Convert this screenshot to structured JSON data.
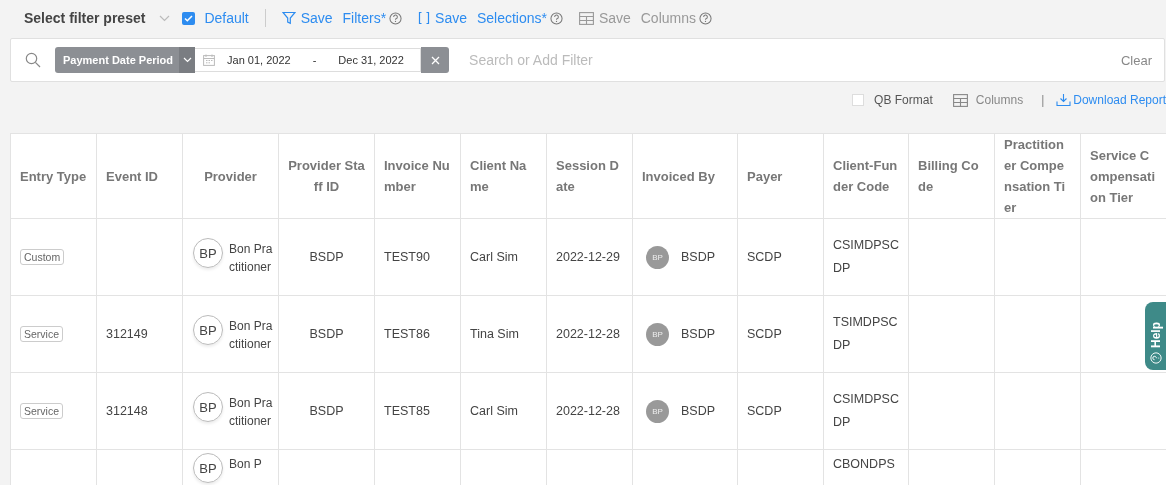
{
  "preset_bar": {
    "label": "Select filter preset",
    "default": {
      "label": "Default",
      "checked": true
    },
    "actions": [
      {
        "label": "Save Filters*",
        "disabled": false
      },
      {
        "label": "Save Selections*",
        "disabled": false
      },
      {
        "label": "Save Columns",
        "disabled": true
      }
    ]
  },
  "filter_bar": {
    "chip": "Payment Date Period",
    "date_from": "Jan 01, 2022",
    "date_separator": "-",
    "date_to": "Dec 31, 2022",
    "placeholder": "Search or Add Filter",
    "clear": "Clear"
  },
  "options": {
    "qb_format": {
      "label": "QB Format",
      "checked": false
    },
    "columns": "Columns",
    "separator": "|",
    "download": "Download Report"
  },
  "table": {
    "columns": [
      {
        "label": "Entry Type"
      },
      {
        "label": "Event ID"
      },
      {
        "label": "Provider"
      },
      {
        "label": "Provider Staff ID"
      },
      {
        "label": "Invoice Number"
      },
      {
        "label": "Client Name"
      },
      {
        "label": "Session Date"
      },
      {
        "label": "Invoiced By"
      },
      {
        "label": "Payer"
      },
      {
        "label": "Client-Funder Code"
      },
      {
        "label": "Billing Code"
      },
      {
        "label": "Practitioner Compensation Tier"
      },
      {
        "label": "Service Compensation Tier"
      }
    ],
    "rows": [
      {
        "entry_type": "Custom",
        "provider": {
          "initials": "BP",
          "name": "Bon Practitioner"
        },
        "staff_id": "BSDP",
        "invoice": "TEST90",
        "client": "Carl Sim",
        "session_date": "2022-12-29",
        "invoiced_by": {
          "initials": "BP",
          "name": "BSDP"
        },
        "payer": "SCDP",
        "funder_code": "CSIMDPSCDP"
      },
      {
        "entry_type": "Service",
        "event_id": "312149",
        "provider": {
          "initials": "BP",
          "name": "Bon Practitioner"
        },
        "staff_id": "BSDP",
        "invoice": "TEST86",
        "client": "Tina Sim",
        "session_date": "2022-12-28",
        "invoiced_by": {
          "initials": "BP",
          "name": "BSDP"
        },
        "payer": "SCDP",
        "funder_code": "TSIMDPSCDP"
      },
      {
        "entry_type": "Service",
        "event_id": "312148",
        "provider": {
          "initials": "BP",
          "name": "Bon Practitioner"
        },
        "staff_id": "BSDP",
        "invoice": "TEST85",
        "client": "Carl Sim",
        "session_date": "2022-12-28",
        "invoiced_by": {
          "initials": "BP",
          "name": "BSDP"
        },
        "payer": "SCDP",
        "funder_code": "CSIMDPSCDP"
      },
      {
        "provider": {
          "initials": "BP",
          "name": "Bon P"
        },
        "funder_code": "CBONDPS"
      }
    ]
  },
  "help_tab": {
    "label": "Help"
  }
}
